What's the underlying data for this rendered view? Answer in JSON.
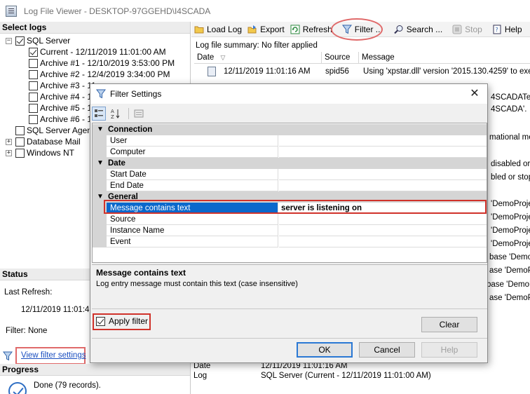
{
  "window": {
    "title": "Log File Viewer - DESKTOP-97GGEHD\\I4SCADA"
  },
  "left": {
    "select_logs_header": "Select logs",
    "tree": [
      {
        "label": "SQL Server",
        "checked": true,
        "expander": "−"
      },
      {
        "label": "Current - 12/11/2019 11:01:00 AM",
        "checked": true
      },
      {
        "label": "Archive #1 - 12/10/2019 3:53:00 PM",
        "checked": false
      },
      {
        "label": "Archive #2 - 12/4/2019 3:34:00 PM",
        "checked": false
      },
      {
        "label": "Archive #3 - 11",
        "checked": false
      },
      {
        "label": "Archive #4 - 11",
        "checked": false
      },
      {
        "label": "Archive #5 - 11",
        "checked": false
      },
      {
        "label": "Archive #6 - 11",
        "checked": false
      },
      {
        "label": "SQL Server Agent",
        "checked": false
      },
      {
        "label": "Database Mail",
        "checked": false,
        "expander": "+"
      },
      {
        "label": "Windows NT",
        "checked": false,
        "expander": "+"
      }
    ],
    "status_header": "Status",
    "last_refresh_label": "Last Refresh:",
    "last_refresh_value": "12/11/2019 11:01:4",
    "filter_label": "Filter: None",
    "view_filter_link": "View filter settings",
    "progress_header": "Progress",
    "progress_text": "Done (79 records)."
  },
  "toolbar": {
    "load_log": "Load Log",
    "export": "Export",
    "refresh": "Refresh",
    "filter": "Filter ...",
    "search": "Search ...",
    "stop": "Stop",
    "help": "Help"
  },
  "grid": {
    "summary": "Log file summary: No filter applied",
    "headers": [
      "Date",
      "Source",
      "Message"
    ],
    "first_row": {
      "date": "12/11/2019 11:01:16 AM",
      "source": "spid56",
      "message": "Using 'xpstar.dll' version '2015.130.4259' to execut"
    },
    "right_fragments": [
      "4SCADATem",
      "4SCADA'.",
      "mational mes",
      "disabled or s",
      "bled or stopp",
      "'DemoProje",
      "'DemoProjec",
      "'DemoProjec",
      "'DemoProjec",
      "base 'DemoP",
      "ase 'DemoPr",
      "base 'DemoPr",
      "ase 'DemoPr"
    ]
  },
  "details": {
    "rows": [
      {
        "label": "Date",
        "value": "12/11/2019 11:01:16 AM"
      },
      {
        "label": "Log",
        "value": "SQL Server (Current - 12/11/2019 11:01:00 AM)"
      }
    ]
  },
  "dialog": {
    "title": "Filter Settings",
    "categories": [
      {
        "name": "Connection",
        "props": [
          {
            "name": "User",
            "value": ""
          },
          {
            "name": "Computer",
            "value": ""
          }
        ]
      },
      {
        "name": "Date",
        "props": [
          {
            "name": "Start Date",
            "value": ""
          },
          {
            "name": "End Date",
            "value": ""
          }
        ]
      },
      {
        "name": "General",
        "props": [
          {
            "name": "Message contains text",
            "value": "server is listening on",
            "selected": true
          },
          {
            "name": "Source",
            "value": ""
          },
          {
            "name": "Instance Name",
            "value": ""
          },
          {
            "name": "Event",
            "value": ""
          }
        ]
      }
    ],
    "desc_title": "Message contains text",
    "desc_text": "Log entry message must contain this text (case insensitive)",
    "apply_filter_label": "Apply filter",
    "apply_filter_checked": true,
    "clear": "Clear",
    "ok": "OK",
    "cancel": "Cancel",
    "help": "Help"
  }
}
